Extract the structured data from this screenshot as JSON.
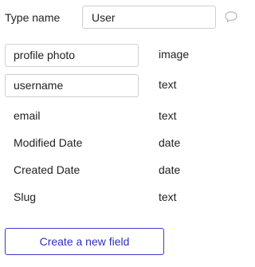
{
  "type_name": {
    "label": "Type name",
    "value": "User"
  },
  "fields": [
    {
      "name": "profile photo",
      "type": "image",
      "boxed": true
    },
    {
      "name": "username",
      "type": "text",
      "boxed": true
    },
    {
      "name": "email",
      "type": "text",
      "boxed": false
    },
    {
      "name": "Modified Date",
      "type": "date",
      "boxed": false
    },
    {
      "name": "Created Date",
      "type": "date",
      "boxed": false
    },
    {
      "name": "Slug",
      "type": "text",
      "boxed": false
    }
  ],
  "create_button": {
    "label": "Create a new field"
  },
  "icons": {
    "comment": "comment-icon"
  },
  "colors": {
    "accent": "#2f2fc0",
    "border": "#cfcfcf",
    "icon": "#b8b8b8"
  }
}
